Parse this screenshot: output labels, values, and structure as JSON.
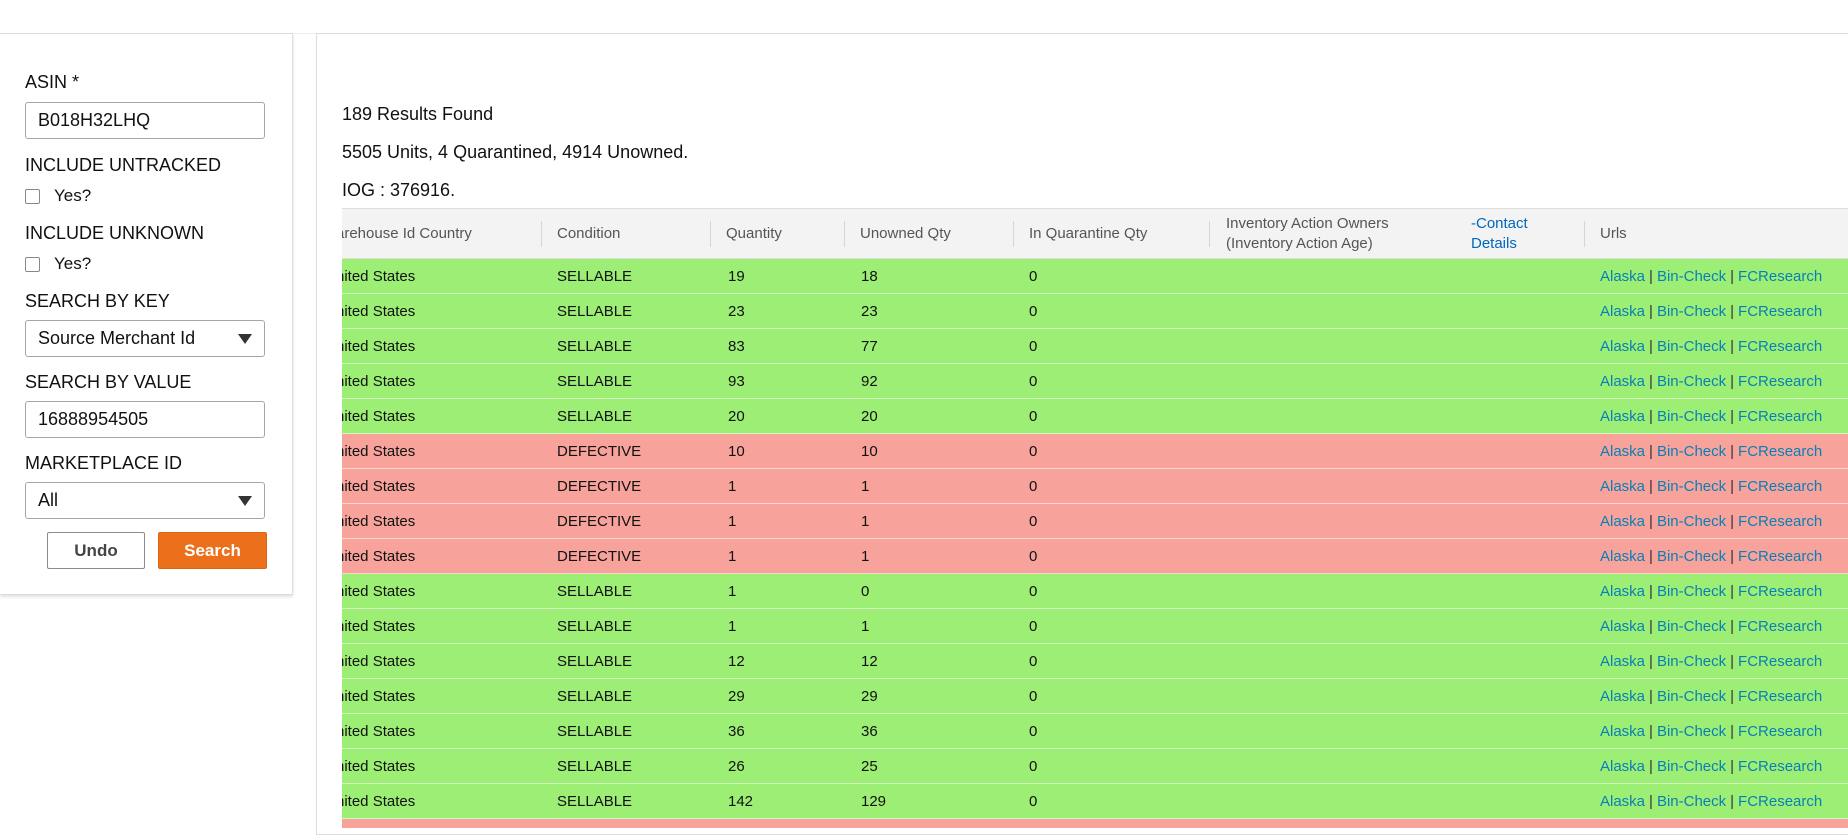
{
  "filters": {
    "asin": {
      "label": "ASIN *",
      "value": "B018H32LHQ"
    },
    "include_untracked": {
      "label": "INCLUDE UNTRACKED",
      "checkbox_label": "Yes?"
    },
    "include_unknown": {
      "label": "INCLUDE UNKNOWN",
      "checkbox_label": "Yes?"
    },
    "search_by_key": {
      "label": "SEARCH BY KEY",
      "selected": "Source Merchant Id"
    },
    "search_by_value": {
      "label": "SEARCH BY VALUE",
      "value": "16888954505"
    },
    "marketplace_id": {
      "label": "MARKETPLACE ID",
      "selected": "All"
    },
    "undo_label": "Undo",
    "search_label": "Search",
    "search_button_color": "#ec6f1b"
  },
  "results": {
    "count_text": "189 Results Found",
    "units_text": "5505 Units, 4 Quarantined, 4914 Unowned.",
    "iog_text": "IOG : 376916."
  },
  "table": {
    "headers": {
      "country": "arehouse Id Country",
      "condition": "Condition",
      "quantity": "Quantity",
      "unowned": "Unowned Qty",
      "quarantine": "In Quarantine Qty",
      "owners_line1": "Inventory Action Owners",
      "owners_line2": "(Inventory Action Age)",
      "contact_line1": "-Contact",
      "contact_line2": "Details",
      "urls": "Urls"
    },
    "link_labels": {
      "alaska": "Alaska",
      "bincheck": "Bin-Check",
      "fcresearch": "FCResearch",
      "sep": "|"
    },
    "row_colors": {
      "sellable": "#9cef74",
      "defective": "#f7a39b"
    },
    "rows": [
      {
        "country": "nited States",
        "condition": "SELLABLE",
        "quantity": "19",
        "unowned": "18",
        "quarantine": "0"
      },
      {
        "country": "nited States",
        "condition": "SELLABLE",
        "quantity": "23",
        "unowned": "23",
        "quarantine": "0"
      },
      {
        "country": "nited States",
        "condition": "SELLABLE",
        "quantity": "83",
        "unowned": "77",
        "quarantine": "0"
      },
      {
        "country": "nited States",
        "condition": "SELLABLE",
        "quantity": "93",
        "unowned": "92",
        "quarantine": "0"
      },
      {
        "country": "nited States",
        "condition": "SELLABLE",
        "quantity": "20",
        "unowned": "20",
        "quarantine": "0"
      },
      {
        "country": "nited States",
        "condition": "DEFECTIVE",
        "quantity": "10",
        "unowned": "10",
        "quarantine": "0"
      },
      {
        "country": "nited States",
        "condition": "DEFECTIVE",
        "quantity": "1",
        "unowned": "1",
        "quarantine": "0"
      },
      {
        "country": "nited States",
        "condition": "DEFECTIVE",
        "quantity": "1",
        "unowned": "1",
        "quarantine": "0"
      },
      {
        "country": "nited States",
        "condition": "DEFECTIVE",
        "quantity": "1",
        "unowned": "1",
        "quarantine": "0"
      },
      {
        "country": "nited States",
        "condition": "SELLABLE",
        "quantity": "1",
        "unowned": "0",
        "quarantine": "0"
      },
      {
        "country": "nited States",
        "condition": "SELLABLE",
        "quantity": "1",
        "unowned": "1",
        "quarantine": "0"
      },
      {
        "country": "nited States",
        "condition": "SELLABLE",
        "quantity": "12",
        "unowned": "12",
        "quarantine": "0"
      },
      {
        "country": "nited States",
        "condition": "SELLABLE",
        "quantity": "29",
        "unowned": "29",
        "quarantine": "0"
      },
      {
        "country": "nited States",
        "condition": "SELLABLE",
        "quantity": "36",
        "unowned": "36",
        "quarantine": "0"
      },
      {
        "country": "nited States",
        "condition": "SELLABLE",
        "quantity": "26",
        "unowned": "25",
        "quarantine": "0"
      },
      {
        "country": "nited States",
        "condition": "SELLABLE",
        "quantity": "142",
        "unowned": "129",
        "quarantine": "0"
      }
    ]
  }
}
